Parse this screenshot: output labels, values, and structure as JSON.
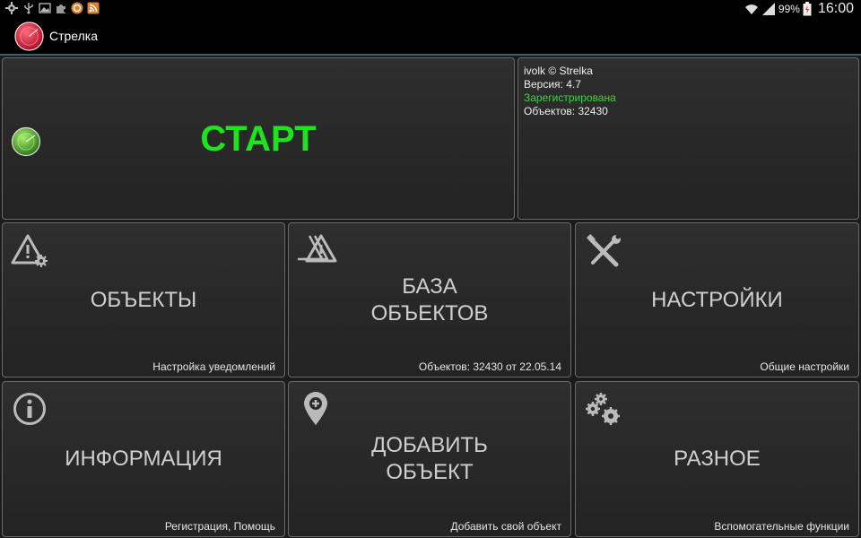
{
  "status_bar": {
    "battery": "99%",
    "time": "16:00",
    "icons": [
      "settings-icon",
      "usb-icon",
      "image-icon",
      "puzzle-icon",
      "sync-icon",
      "rss-icon",
      "wifi-icon",
      "signal-icon",
      "battery-icon"
    ]
  },
  "app": {
    "title": "Стрелка",
    "accent": "#1ee41e"
  },
  "start_tile": {
    "label": "СТАРТ"
  },
  "info_panel": {
    "line1": "ivolk © Strelka",
    "line2": "Версия: 4.7",
    "line3": "Зарегистрирована",
    "line4": "Объектов: 32430"
  },
  "tiles": [
    {
      "label": "ОБЪЕКТЫ",
      "sub": "Настройка уведомлений",
      "icon": "warning-settings-icon"
    },
    {
      "label": "БАЗА\nОБЪЕКТОВ",
      "sub": "Объектов: 32430 от 22.05.14",
      "icon": "warnings-stack-icon"
    },
    {
      "label": "НАСТРОЙКИ",
      "sub": "Общие настройки",
      "icon": "tools-icon"
    },
    {
      "label": "ИНФОРМАЦИЯ",
      "sub": "Регистрация, Помощь",
      "icon": "info-icon"
    },
    {
      "label": "ДОБАВИТЬ\nОБЪЕКТ",
      "sub": "Добавить свой объект",
      "icon": "add-location-icon"
    },
    {
      "label": "РАЗНОЕ",
      "sub": "Вспомогательные функции",
      "icon": "gears-icon"
    }
  ]
}
